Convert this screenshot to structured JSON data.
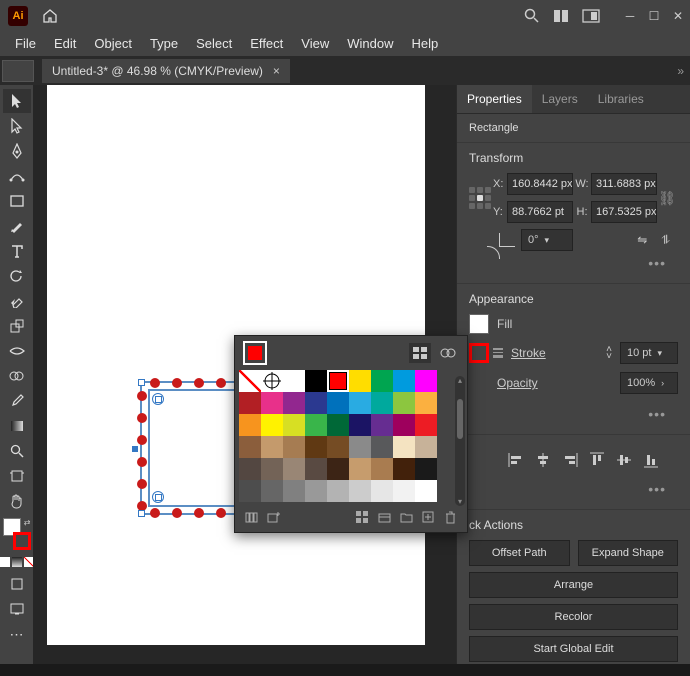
{
  "title": "Adobe Illustrator",
  "doc_tab": {
    "label": "Untitled-3* @ 46.98 % (CMYK/Preview)",
    "close": "×"
  },
  "menu": [
    "File",
    "Edit",
    "Object",
    "Type",
    "Select",
    "Effect",
    "View",
    "Window",
    "Help"
  ],
  "sidebar_hint": "",
  "panel": {
    "tabs": [
      "Properties",
      "Layers",
      "Libraries"
    ],
    "object_type": "Rectangle",
    "transform": {
      "title": "Transform",
      "xl": "X:",
      "yl": "Y:",
      "wl": "W:",
      "hl": "H:",
      "x": "160.8442 px",
      "y": "88.7662 pt",
      "w": "311.6883 px",
      "h": "167.5325 px",
      "rot": "0°"
    },
    "appearance": {
      "title": "Appearance",
      "fill": "Fill",
      "stroke": "Stroke",
      "stroke_val": "10 pt",
      "opacity": "Opacity",
      "opacity_val": "100%"
    },
    "quick": {
      "title": "ck Actions",
      "offset": "Offset Path",
      "expand": "Expand Shape",
      "arrange": "Arrange",
      "recolor": "Recolor",
      "global": "Start Global Edit"
    }
  },
  "swatches": {
    "rows": [
      [
        "none",
        "reg",
        "#ffffff",
        "#000000",
        "#ff0000:sel",
        "#ffdd00",
        "#00a550",
        "#009bde",
        "#ff00ff"
      ],
      [
        "#b21f24",
        "#e8308a",
        "#92278f",
        "#2b3990",
        "#0071bc",
        "#29abe2",
        "#00a99d",
        "#8cc63f",
        "#fbb040"
      ],
      [
        "#f7941e",
        "#fff200",
        "#d7df23",
        "#39b54a",
        "#006837",
        "#1b1464",
        "#662d91",
        "#9e005d",
        "#ed1c24"
      ],
      [
        "#8b5e3c",
        "#c49a6c",
        "#a67c52",
        "#603913",
        "#754c24",
        "#8a8a8a",
        "#58595b",
        "#f4e3c1",
        "#c7b299"
      ],
      [
        "#534741",
        "#736357",
        "#998675",
        "#594a42",
        "#3c2415",
        "#c69c6d",
        "#a97c50",
        "#42210b",
        "#1a1a1a"
      ],
      [
        "#4d4d4d",
        "#666666",
        "#808080",
        "#999999",
        "#b3b3b3",
        "#cccccc",
        "#e6e6e6",
        "#f2f2f2",
        "#ffffff"
      ]
    ]
  }
}
